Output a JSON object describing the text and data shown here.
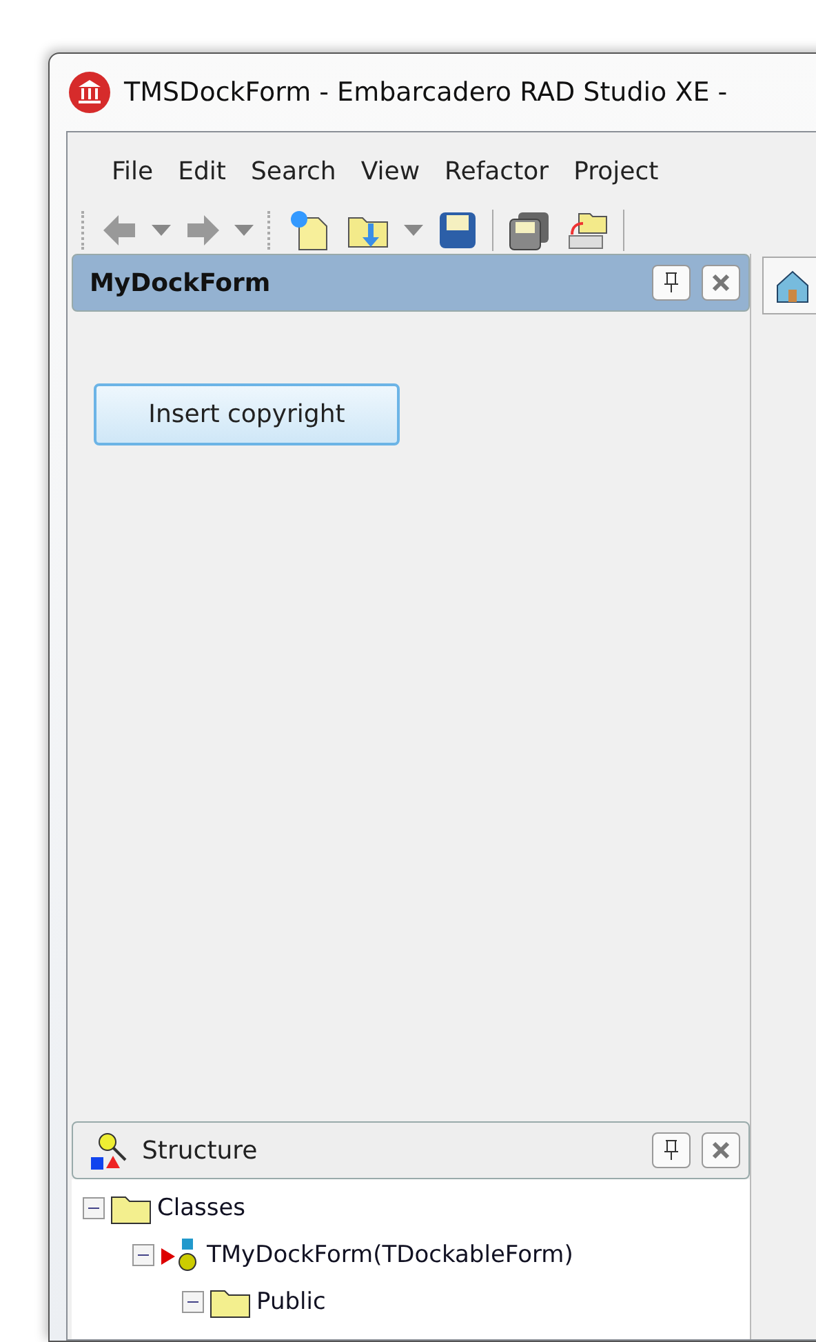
{
  "window": {
    "title": "TMSDockForm - Embarcadero RAD Studio XE -"
  },
  "menu": [
    "File",
    "Edit",
    "Search",
    "View",
    "Refactor",
    "Project"
  ],
  "dock_panel": {
    "title": "MyDockForm",
    "button": "Insert copyright"
  },
  "structure": {
    "title": "Structure",
    "tree": [
      {
        "label": "Classes",
        "kind": "folder",
        "expanded": true,
        "children": [
          {
            "label": "TMyDockForm(TDockableForm)",
            "kind": "class",
            "expanded": true,
            "children": [
              {
                "label": "Public",
                "kind": "folder",
                "expanded": true
              }
            ]
          }
        ]
      }
    ]
  }
}
